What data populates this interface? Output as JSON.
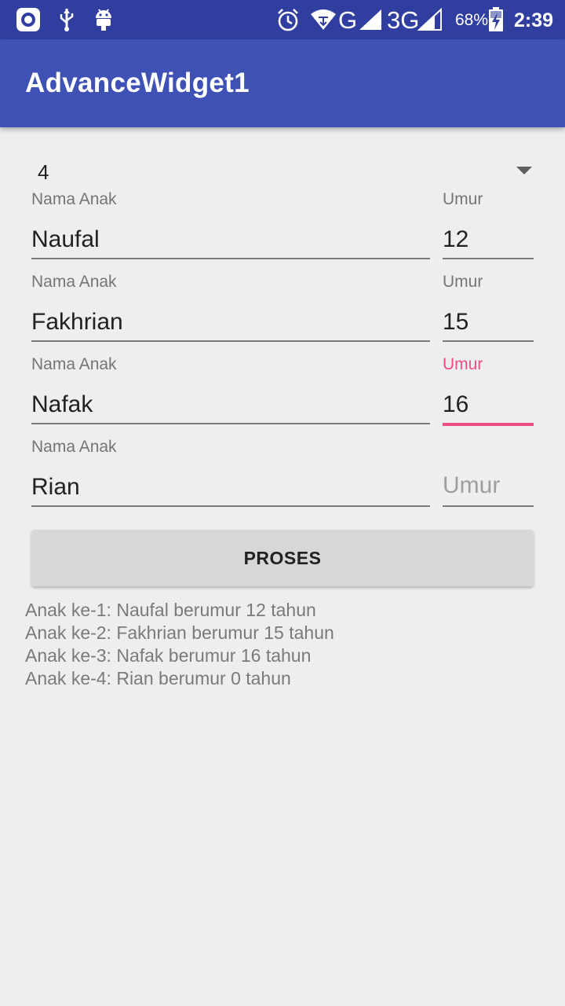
{
  "status_bar": {
    "battery_percent": "68%",
    "network_g": "G",
    "network_3g": "3G",
    "time": "2:39",
    "icons": [
      "media-icon",
      "usb-icon",
      "android-icon",
      "alarm-icon",
      "wifi-icon",
      "signal-icon",
      "signal-icon",
      "battery-charging-icon"
    ]
  },
  "app_bar": {
    "title": "AdvanceWidget1"
  },
  "spinner": {
    "value": "4"
  },
  "form": {
    "rows": [
      {
        "name_label": "Nama Anak",
        "name_value": "Naufal",
        "age_label": "Umur",
        "age_value": "12"
      },
      {
        "name_label": "Nama Anak",
        "name_value": "Fakhrian",
        "age_label": "Umur",
        "age_value": "15"
      },
      {
        "name_label": "Nama Anak",
        "name_value": "Nafak",
        "age_label": "Umur",
        "age_value": "16"
      },
      {
        "name_label": "Nama Anak",
        "name_value": "Rian",
        "age_hint": "Umur"
      }
    ]
  },
  "button": {
    "label": "PROSES"
  },
  "result": {
    "lines": [
      "Anak ke-1: Naufal berumur 12 tahun",
      "Anak ke-2: Fakhrian berumur 15 tahun",
      "Anak ke-3: Nafak berumur 16 tahun",
      "Anak ke-4: Rian berumur 0 tahun"
    ]
  },
  "colors": {
    "status_bar": "#303f9f",
    "app_bar": "#3f51b5",
    "accent": "#ee4d7f",
    "background": "#eeeeee"
  }
}
